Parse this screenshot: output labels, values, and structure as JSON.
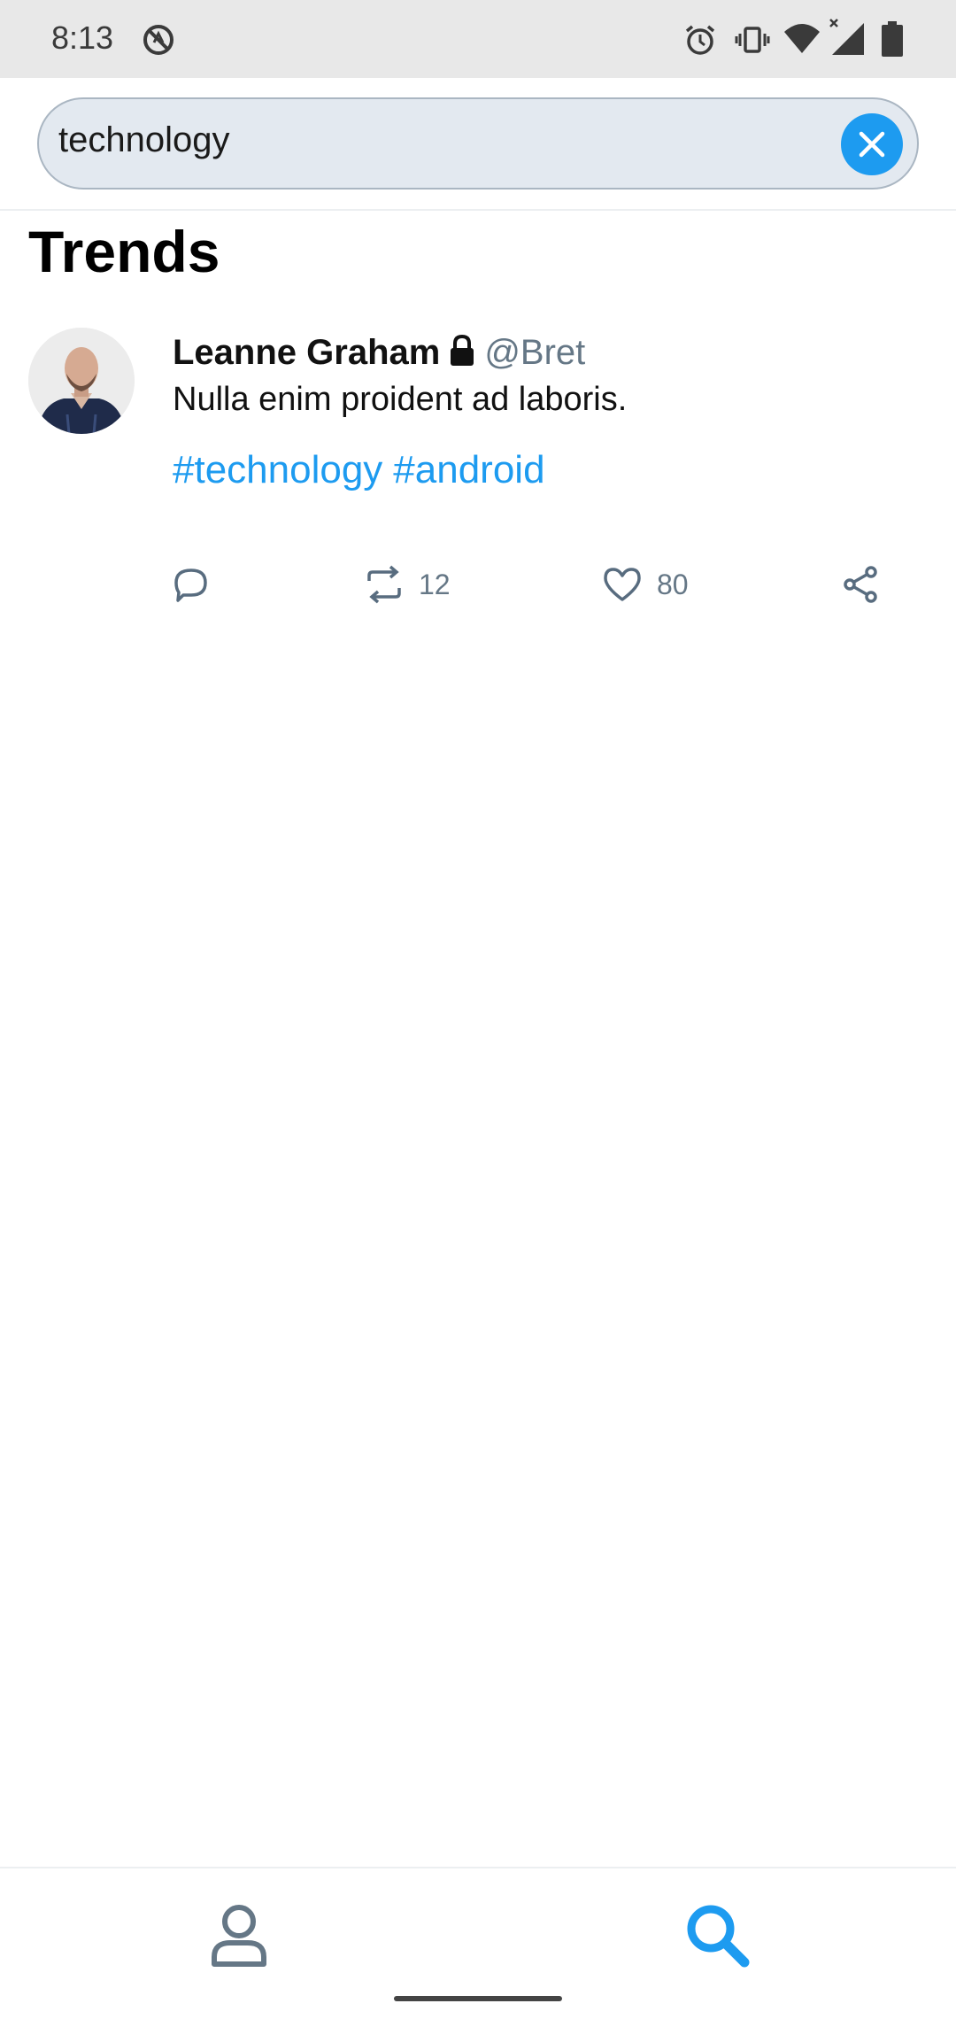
{
  "status_bar": {
    "time": "8:13",
    "icons": [
      "do-not-disturb-icon",
      "alarm-icon",
      "vibrate-icon",
      "wifi-icon",
      "cellular-signal-icon",
      "battery-icon"
    ]
  },
  "search": {
    "query": "technology",
    "clear_icon": "close-icon"
  },
  "section": {
    "title": "Trends"
  },
  "tweet": {
    "author_name": "Leanne Graham",
    "handle": "@Bret",
    "protected_icon": "lock-icon",
    "text": "Nulla enim proident ad laboris.",
    "hashtags": [
      "#technology",
      "#android"
    ],
    "actions": {
      "reply_icon": "reply-icon",
      "retweet_count": "12",
      "like_count": "80",
      "share_icon": "share-icon"
    }
  },
  "bottom_nav": {
    "items": [
      {
        "icon": "profile-icon",
        "active": false
      },
      {
        "icon": "search-icon",
        "active": true
      }
    ]
  },
  "colors": {
    "accent": "#1d9bf0",
    "secondary_text": "#657786",
    "search_background": "#e3e9f0"
  }
}
